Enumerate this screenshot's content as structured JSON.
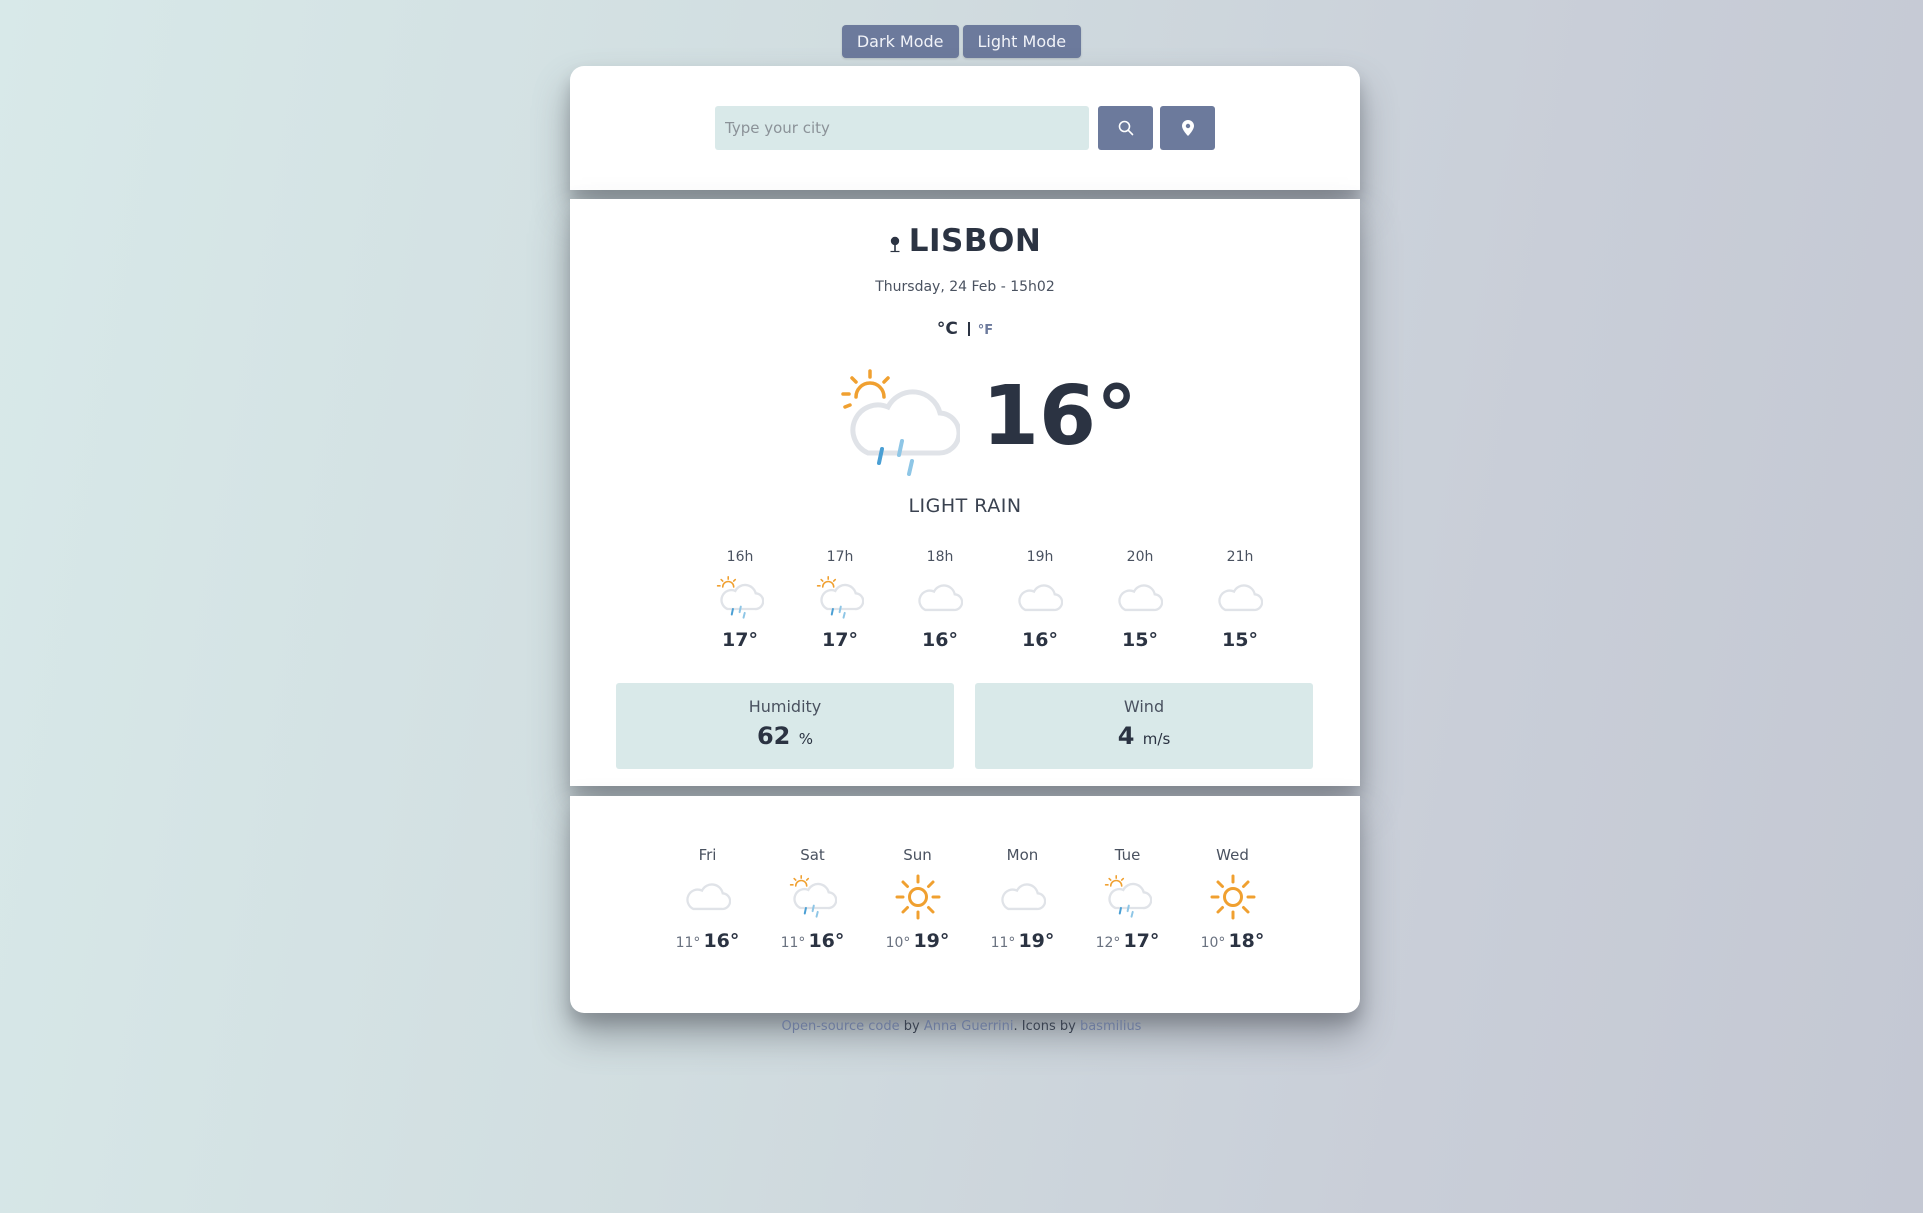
{
  "mode_buttons": {
    "dark": "Dark Mode",
    "light": "Light Mode"
  },
  "search": {
    "placeholder": "Type your city",
    "search_icon": "search-icon",
    "location_icon": "location-pin-icon"
  },
  "current": {
    "city": "LISBON",
    "date": "Thursday, 24 Feb - 15h02",
    "unit_c": "°C",
    "unit_f": "°F",
    "temp": "16°",
    "description": "LIGHT RAIN",
    "icon": "partly-sunny-rain-icon"
  },
  "hourly": [
    {
      "time": "16h",
      "temp": "17°",
      "icon": "partly-sunny-rain-icon"
    },
    {
      "time": "17h",
      "temp": "17°",
      "icon": "partly-sunny-rain-icon"
    },
    {
      "time": "18h",
      "temp": "16°",
      "icon": "cloud-icon"
    },
    {
      "time": "19h",
      "temp": "16°",
      "icon": "cloud-icon"
    },
    {
      "time": "20h",
      "temp": "15°",
      "icon": "cloud-icon"
    },
    {
      "time": "21h",
      "temp": "15°",
      "icon": "cloud-icon"
    }
  ],
  "humidity": {
    "label": "Humidity",
    "value": "62",
    "unit": "%"
  },
  "wind": {
    "label": "Wind",
    "value": "4",
    "unit": "m/s"
  },
  "daily": [
    {
      "day": "Fri",
      "min": "11°",
      "max": "16°",
      "icon": "cloud-icon"
    },
    {
      "day": "Sat",
      "min": "11°",
      "max": "16°",
      "icon": "partly-sunny-rain-icon"
    },
    {
      "day": "Sun",
      "min": "10°",
      "max": "19°",
      "icon": "sun-icon"
    },
    {
      "day": "Mon",
      "min": "11°",
      "max": "19°",
      "icon": "cloud-icon"
    },
    {
      "day": "Tue",
      "min": "12°",
      "max": "17°",
      "icon": "partly-sunny-rain-icon"
    },
    {
      "day": "Wed",
      "min": "10°",
      "max": "18°",
      "icon": "sun-icon"
    }
  ],
  "footer": {
    "link1": "Open-source code",
    "by": " by ",
    "link2": "Anna Guerrini",
    "icons_by": ". Icons by ",
    "link3": "basmilius"
  },
  "colors": {
    "accent": "#6c7a9c",
    "panel": "#d9e9e9",
    "text": "#2b3342",
    "sun": "#f0a030",
    "rain": "#4a9fd4"
  }
}
